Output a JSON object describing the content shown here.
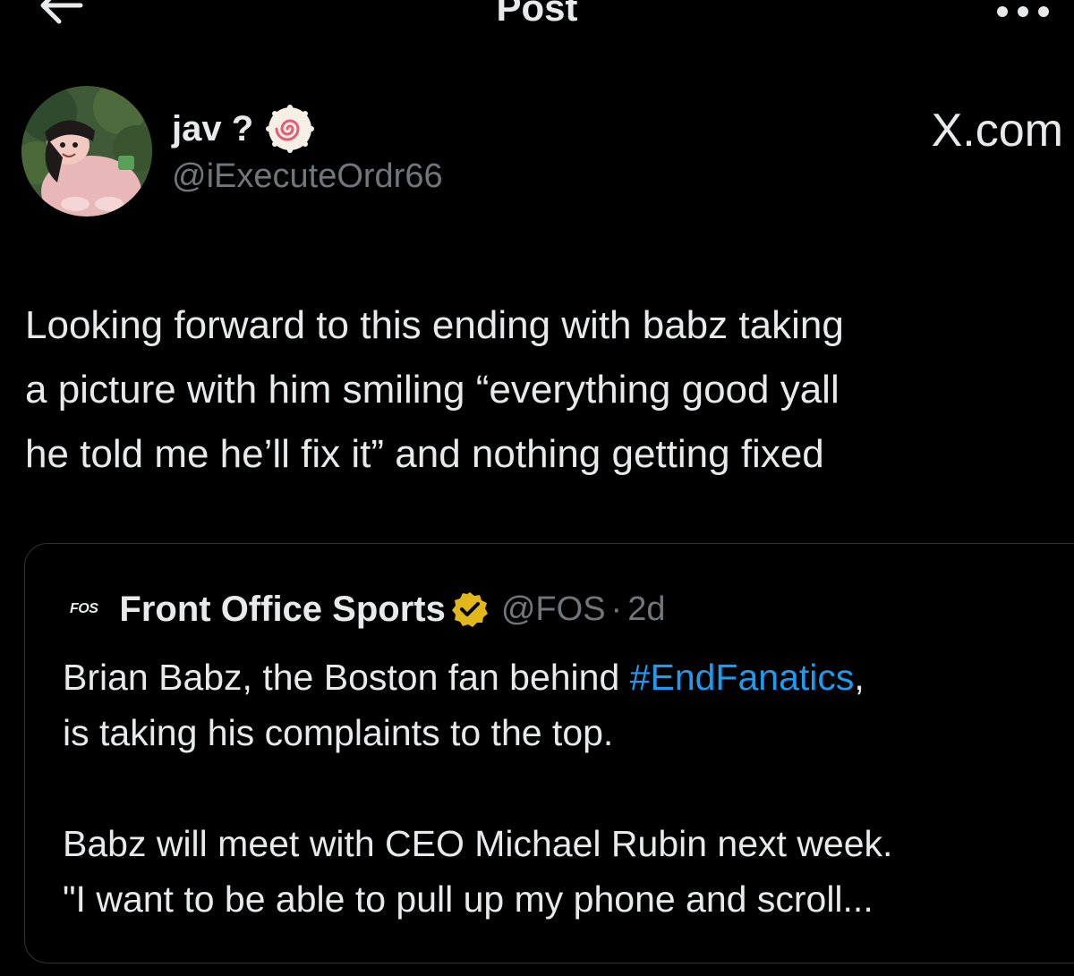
{
  "header": {
    "title": "Post",
    "back_icon": "arrow-left-icon",
    "more_icon": "more-horizontal-icon"
  },
  "author": {
    "display_name": "jav ?",
    "emoji": "narutomaki-swirl-icon",
    "username": "@iExecuteOrdr66"
  },
  "site_label": "X.com",
  "tweet": {
    "lines": [
      "Looking forward to this ending with babz taking",
      "a picture with him smiling “everything good yall",
      "he told me he’ll fix it” and nothing getting fixed"
    ]
  },
  "quote": {
    "logo_text": "FOS",
    "name": "Front Office Sports",
    "verified_icon": "verified-gold-badge-icon",
    "handle": "@FOS",
    "separator": "·",
    "time": "2d",
    "line1_before": "Brian Babz, the Boston fan behind ",
    "hashtag": "#EndFanatics",
    "line1_after": ",",
    "line2": "is taking his complaints to the top.",
    "line3": "Babz will meet with CEO Michael Rubin next week.",
    "line4": "\"I want to be able to pull up my phone and scroll..."
  },
  "colors": {
    "background": "#000000",
    "text_primary": "#e7e9ea",
    "text_secondary": "#71767b",
    "link": "#1d9bf0",
    "border": "#2f3336",
    "verified_gold": "#e2b719"
  }
}
